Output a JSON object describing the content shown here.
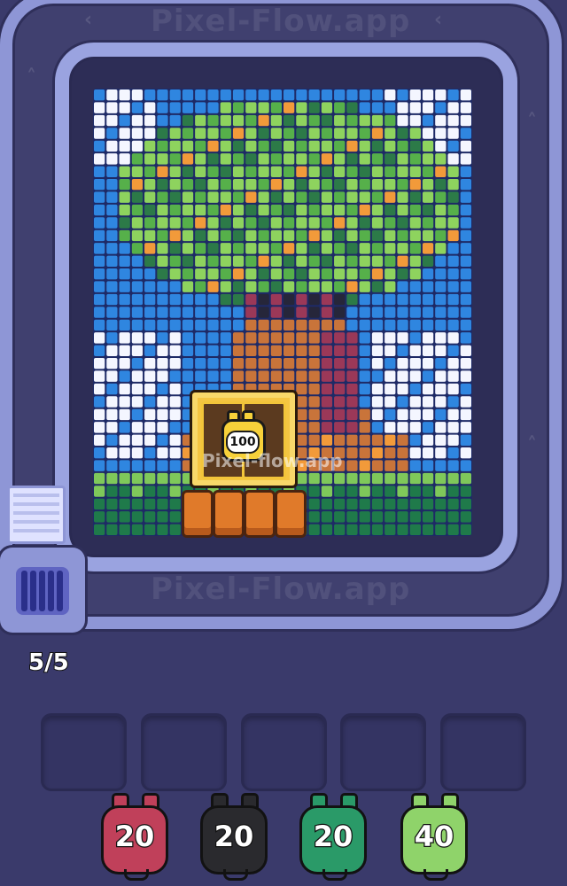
{
  "watermark": "Pixel-Flow.app",
  "board_watermark": "Pixel-flow.app",
  "conveyor": {
    "counter": "5/5"
  },
  "board": {
    "cols": 30,
    "rows": 35,
    "palette": {
      "sky": "#2f86e0",
      "cloud": "#f4f6ff",
      "leaf_light": "#8ed35e",
      "leaf_mid": "#56b04a",
      "leaf_dark": "#2c7a48",
      "trunk": "#c9743a",
      "trunk_shadow": "#9b3858",
      "ground_light": "#7fc85a",
      "ground_dark": "#1f7a4a",
      "dark": "#26263a",
      "orange": "#f29a3a"
    }
  },
  "chest": {
    "label": "100",
    "color": "#f4c542"
  },
  "slots": {
    "count": 5
  },
  "shooters": [
    {
      "label": "20",
      "color": "#c0405a"
    },
    {
      "label": "20",
      "color": "#2a2a2e"
    },
    {
      "label": "20",
      "color": "#2a9a68"
    },
    {
      "label": "40",
      "color": "#8fd36a"
    }
  ]
}
